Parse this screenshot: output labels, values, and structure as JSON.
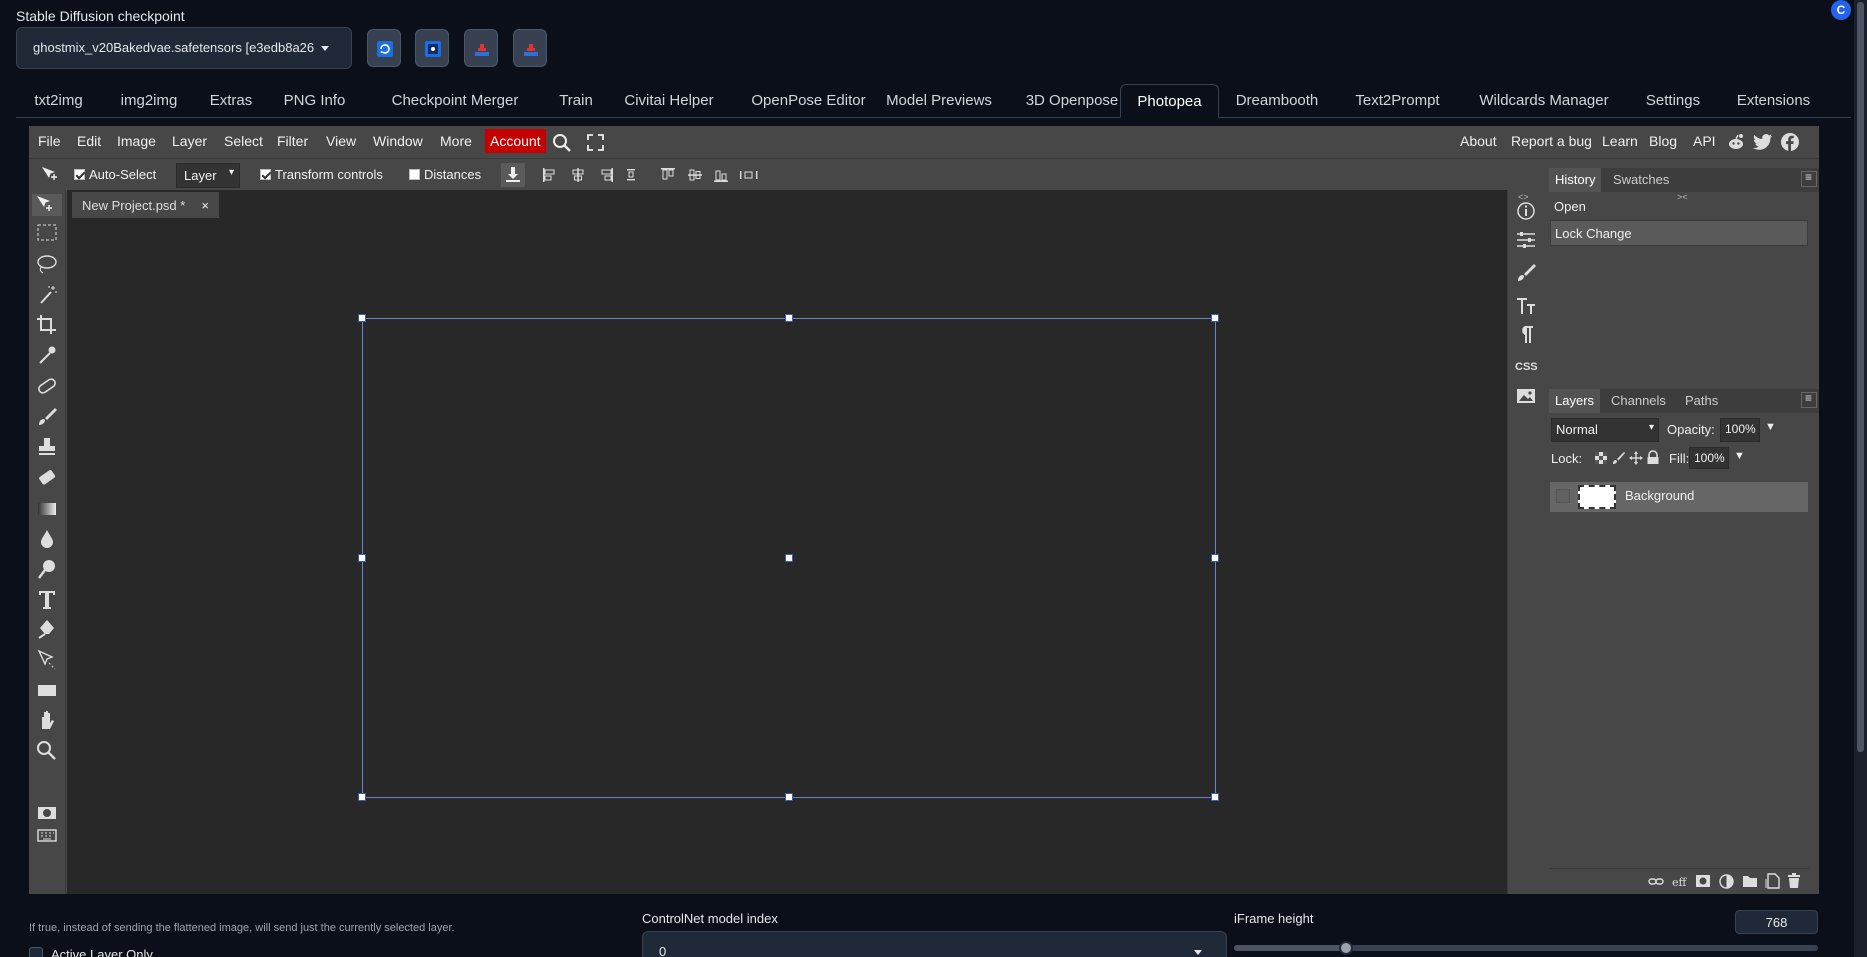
{
  "checkpoint": {
    "label": "Stable Diffusion checkpoint",
    "value": "ghostmix_v20Bakedvae.safetensors [e3edb8a26"
  },
  "corner_badge": "C",
  "tabs": [
    {
      "label": "txt2img"
    },
    {
      "label": "img2img"
    },
    {
      "label": "Extras"
    },
    {
      "label": "PNG Info"
    },
    {
      "label": "Checkpoint Merger"
    },
    {
      "label": "Train"
    },
    {
      "label": "Civitai Helper"
    },
    {
      "label": "OpenPose Editor"
    },
    {
      "label": "Model Previews"
    },
    {
      "label": "3D Openpose"
    },
    {
      "label": "Photopea"
    },
    {
      "label": "Dreambooth"
    },
    {
      "label": "Text2Prompt"
    },
    {
      "label": "Wildcards Manager"
    },
    {
      "label": "Settings"
    },
    {
      "label": "Extensions"
    }
  ],
  "active_tab": "Photopea",
  "photopea": {
    "menu": [
      "File",
      "Edit",
      "Image",
      "Layer",
      "Select",
      "Filter",
      "View",
      "Window",
      "More",
      "Account"
    ],
    "right_menu": [
      "About",
      "Report a bug",
      "Learn",
      "Blog",
      "API"
    ],
    "options": {
      "auto_select": "Auto-Select",
      "layer_select": "Layer",
      "transform_controls": "Transform controls",
      "distances": "Distances"
    },
    "document_tab": "New Project.psd *",
    "document_close": "×",
    "history": {
      "tabs": [
        "History",
        "Swatches"
      ],
      "items": [
        "Open",
        "Lock Change"
      ]
    },
    "layers": {
      "tabs": [
        "Layers",
        "Channels",
        "Paths"
      ],
      "blend_mode": "Normal",
      "opacity_label": "Opacity:",
      "opacity": "100%",
      "lock_label": "Lock:",
      "fill_label": "Fill:",
      "fill": "100%",
      "items": [
        "Background"
      ]
    },
    "side_icons": {
      "css": "CSS"
    }
  },
  "bottom": {
    "note": "If true, instead of sending the flattened image, will send just the currently selected layer.",
    "active_layer_only": "Active Layer Only",
    "controlnet_label": "ControlNet model index",
    "controlnet_value": "0",
    "iframe_label": "iFrame height",
    "iframe_value": "768",
    "iframe_slider": {
      "min": 0,
      "max": 4000,
      "value": 768
    }
  },
  "colors": {
    "accent_account": "#c40000",
    "selection_border": "#6b83c9",
    "page_bg": "#0b0f19"
  }
}
